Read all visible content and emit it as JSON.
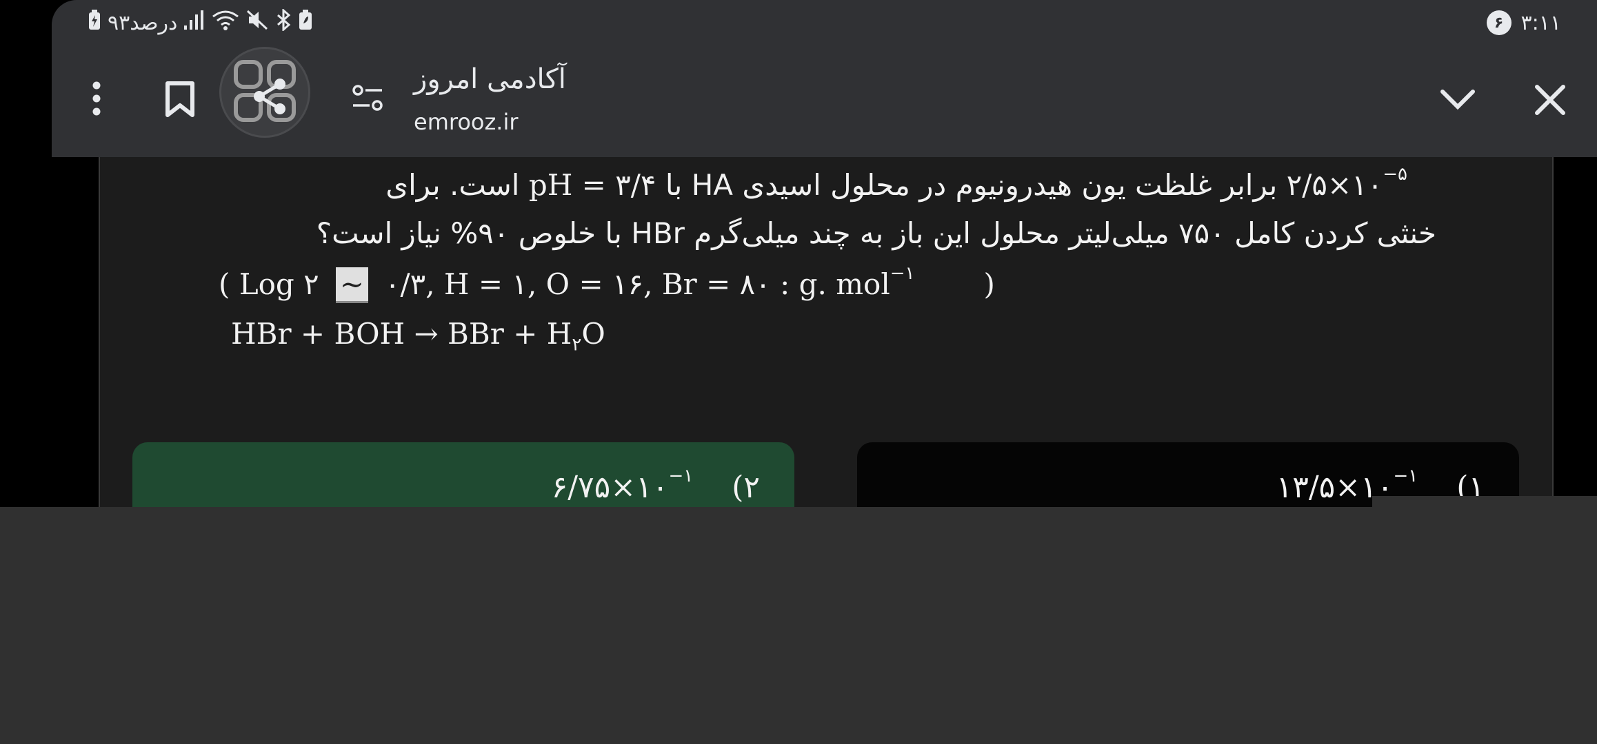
{
  "status_bar": {
    "time": "۳:۱۱",
    "notification_count": "۶",
    "battery_text": "۹۳درصد"
  },
  "toolbar": {
    "site_title": "آکادمی امروز",
    "site_url": "emrooz.ir",
    "icons": [
      "more-vert-icon",
      "bookmark-icon",
      "share-icon",
      "tune-icon",
      "chevron-down-icon",
      "close-icon"
    ]
  },
  "question": {
    "line1_power": "۲/۵×۱۰",
    "line1_exponent": "−۵",
    "line1_text": " برابر غلظت یون هیدرونیوم در محلول اسیدی HA با ",
    "line1_ph": "pH = ۳/۴",
    "line1_end": " است. برای",
    "line2": "خنثی کردن کامل ۷۵۰ میلی‌لیتر محلول این باز به چند میلی‌گرم HBr با خلوص ۹۰% نیاز است؟",
    "line3_open": "( Log ۲",
    "line3_tilde": "~",
    "line3_values": "۰/۳, H = ۱, O = ۱۶, Br = ۸۰ : g. mol",
    "line3_exponent": "−۱",
    "line3_close": ")",
    "equation_left": "HBr + BOH → BBr + H",
    "equation_sub": "۲",
    "equation_right": "O"
  },
  "options": [
    {
      "number": "(۲",
      "value": "۶/۷۵×۱۰",
      "exponent": "−۱"
    },
    {
      "number": "(۱",
      "value": "۱۳/۵×۱۰",
      "exponent": "−۱"
    }
  ],
  "colors": {
    "chrome": "#303134",
    "page": "#1c1c1c",
    "option_selected": "#1f4a31",
    "option_default": "#050505",
    "bottom_panel": "#303030"
  }
}
